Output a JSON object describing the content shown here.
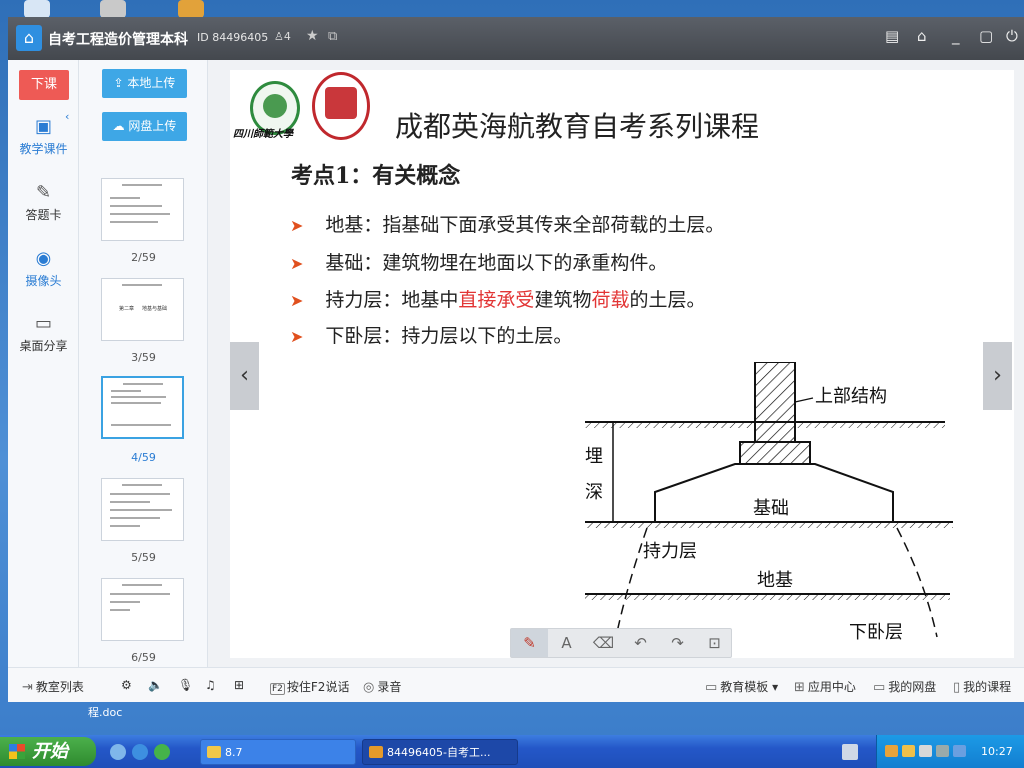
{
  "window": {
    "title": "自考工程造价管理本科",
    "id_text": "ID 84496405",
    "user_count": "4"
  },
  "left_nav": {
    "end_class": "下课",
    "items": [
      {
        "label": "教学课件",
        "icon": "courseware-icon"
      },
      {
        "label": "答题卡",
        "icon": "answer-card-icon"
      },
      {
        "label": "摄像头",
        "icon": "camera-icon"
      },
      {
        "label": "桌面分享",
        "icon": "desktop-share-icon"
      }
    ]
  },
  "thumbs": {
    "local_upload": "本地上传",
    "cloud_upload": "网盘上传",
    "pages": [
      {
        "label": "2/59",
        "inner": ""
      },
      {
        "label": "3/59",
        "inner": "第二章     地基与基础"
      },
      {
        "label": "4/59",
        "inner": ""
      },
      {
        "label": "5/59",
        "inner": ""
      },
      {
        "label": "6/59",
        "inner": ""
      }
    ],
    "selected": "4/59"
  },
  "slide": {
    "logo_text": "四川師範大學",
    "title": "成都英海航教育自考系列课程",
    "point": "考点1：有关概念",
    "bullets": [
      {
        "parts": [
          "地基：指基础下面承受其传来全部荷载的土层。"
        ]
      },
      {
        "parts": [
          "基础：建筑物埋在地面以下的承重构件。"
        ]
      },
      {
        "parts": [
          "持力层：地基中",
          "直接承受",
          "建筑物",
          "荷载",
          "的土层。"
        ]
      },
      {
        "parts": [
          "下卧层：持力层以下的土层。"
        ]
      }
    ],
    "diagram": {
      "upper": "上部结构",
      "depth1": "埋",
      "depth2": "深",
      "foundation": "基础",
      "bearing": "持力层",
      "subgrade": "地基",
      "lower": "下卧层"
    }
  },
  "bottom_bar": {
    "classroom_list": "教室列表",
    "f2_key": "F2",
    "f2_talk": "按住F2说话",
    "record": "录音",
    "edu_template": "教育模板",
    "app_center": "应用中心",
    "my_drive": "我的网盘",
    "my_courses": "我的课程"
  },
  "desktop": {
    "file_text": "程.doc"
  },
  "taskbar": {
    "start": "开始",
    "tasks": [
      {
        "label": "8.7",
        "icon": "folder-icon"
      },
      {
        "label": "84496405-自考工...",
        "icon": "app-icon"
      }
    ],
    "clock": "10:27"
  },
  "colors": {
    "accent": "#3ea7e6",
    "end_button": "#ee5a55",
    "highlight_text": "#e23535",
    "bullet": "#e0501e"
  }
}
